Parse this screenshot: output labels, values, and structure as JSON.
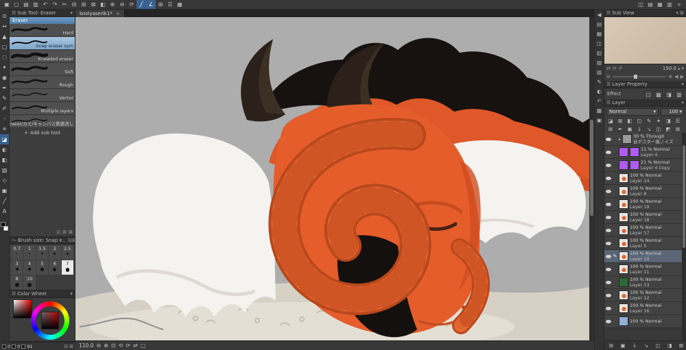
{
  "colors": {
    "accent": "#39618f",
    "selection_blue": "#7fa6cb",
    "canvas_bg": "#adadad",
    "dragon_orange": "#e2662f"
  },
  "top_toolbar": {
    "left_icons": [
      {
        "name": "app-logo-icon",
        "glyph": "▣"
      },
      {
        "name": "new-file-icon",
        "glyph": "▢"
      },
      {
        "name": "open-file-icon",
        "glyph": "▤"
      },
      {
        "name": "save-icon",
        "glyph": "▥"
      },
      {
        "name": "undo-icon",
        "glyph": "↶"
      },
      {
        "name": "redo-icon",
        "glyph": "↷"
      },
      {
        "name": "cut-icon",
        "glyph": "✂"
      },
      {
        "name": "copy-icon",
        "glyph": "⊟"
      },
      {
        "name": "paste-icon",
        "glyph": "⊞"
      },
      {
        "name": "delete-icon",
        "glyph": "⊠"
      },
      {
        "name": "fill-icon",
        "glyph": "◧"
      },
      {
        "name": "zoom-in-icon",
        "glyph": "⊕"
      },
      {
        "name": "zoom-out-icon",
        "glyph": "⊖"
      },
      {
        "name": "rotate-canvas-icon",
        "glyph": "⟳"
      },
      {
        "name": "snap-to-ruler-icon",
        "glyph": "╱",
        "active": true
      },
      {
        "name": "snap-to-special-ruler-icon",
        "glyph": "∠",
        "active": true
      },
      {
        "name": "snap-to-grid-icon",
        "glyph": "⊞"
      },
      {
        "name": "show-ruler-icon",
        "glyph": "☰"
      },
      {
        "name": "show-grid-icon",
        "glyph": "▦"
      }
    ],
    "right_icons": [
      {
        "name": "workspace-panels-icon-1",
        "glyph": "◫"
      },
      {
        "name": "workspace-panels-icon-2",
        "glyph": "▤"
      },
      {
        "name": "workspace-panels-icon-3",
        "glyph": "▦"
      },
      {
        "name": "workspace-panels-icon-4",
        "glyph": "▥"
      },
      {
        "name": "collapse-all-panels-icon",
        "glyph": "»"
      }
    ]
  },
  "left_toolbar": {
    "tools": [
      {
        "name": "zoom-tool-icon",
        "glyph": "⊙"
      },
      {
        "name": "move-tool-icon",
        "glyph": "↔"
      },
      {
        "name": "object-tool-icon",
        "glyph": "▲"
      },
      {
        "name": "selection-tool-icon",
        "glyph": "▢"
      },
      {
        "name": "lasso-tool-icon",
        "glyph": "◌"
      },
      {
        "name": "wand-tool-icon",
        "glyph": "✦"
      },
      {
        "name": "eyedropper-tool-icon",
        "glyph": "◉"
      },
      {
        "name": "pen-tool-icon",
        "glyph": "✒"
      },
      {
        "name": "pencil-tool-icon",
        "glyph": "✎"
      },
      {
        "name": "brush-tool-icon",
        "glyph": "✐"
      },
      {
        "name": "airbrush-tool-icon",
        "glyph": "◦"
      },
      {
        "name": "decoration-tool-icon",
        "glyph": "✳"
      },
      {
        "name": "eraser-tool-icon",
        "glyph": "◪",
        "active": true
      },
      {
        "name": "blend-tool-icon",
        "glyph": "◐"
      },
      {
        "name": "fill-tool-icon",
        "glyph": "◧"
      },
      {
        "name": "gradient-tool-icon",
        "glyph": "▨"
      },
      {
        "name": "figure-tool-icon",
        "glyph": "◇"
      },
      {
        "name": "frame-border-tool-icon",
        "glyph": "▣"
      },
      {
        "name": "ruler-tool-icon",
        "glyph": "╱"
      },
      {
        "name": "text-tool-icon",
        "glyph": "A"
      }
    ]
  },
  "subtool_panel": {
    "title": "Sub Tool: Eraser",
    "tab": "Eraser",
    "items": [
      {
        "label": "Hard",
        "stroke": 3
      },
      {
        "label": "Snap eraser sym",
        "stroke": 2,
        "selected": true
      },
      {
        "label": "Kneaded eraser",
        "stroke": 4.5
      },
      {
        "label": "Soft",
        "stroke": 3.5
      },
      {
        "label": "Rough",
        "stroke": 2.5
      },
      {
        "label": "Vector",
        "stroke": 1.5
      },
      {
        "label": "Multiple layers",
        "stroke": 2
      },
      {
        "label": "Eraser/カミ/キャンバス質感消し",
        "stroke": 1.5
      }
    ],
    "add_button": "Add sub tool",
    "footer_icons": [
      {
        "name": "view-mode-icon",
        "glyph": "⊡"
      },
      {
        "name": "add-subtool-icon",
        "glyph": "⊞"
      },
      {
        "name": "delete-subtool-icon",
        "glyph": "⊠"
      }
    ]
  },
  "brush_size_panel": {
    "title": "Brush size: Snap e..",
    "sizes": [
      "0.7",
      "1",
      "1.5",
      "2",
      "2.5",
      "3",
      "4",
      "5",
      "6",
      "7",
      "8",
      "10"
    ],
    "selected": "7",
    "header_icons": [
      {
        "name": "pressure-settings-icon",
        "glyph": "⊟"
      },
      {
        "name": "close-panel-icon",
        "glyph": "⊠"
      }
    ]
  },
  "color_wheel_panel": {
    "title": "Color Wheel"
  },
  "color_values": [
    "0",
    "0",
    "91"
  ],
  "canvas": {
    "tab": "kostyaserik1*",
    "close_glyph": "×",
    "zoom": "110.0",
    "status_icons_left": [
      {
        "name": "zoom-out-icon",
        "glyph": "⊖"
      },
      {
        "name": "zoom-in-icon",
        "glyph": "⊕"
      },
      {
        "name": "fit-to-screen-icon",
        "glyph": "⊡"
      }
    ],
    "status_icons_right": [
      {
        "name": "rotate-left-icon",
        "glyph": "⟲"
      },
      {
        "name": "rotate-right-icon",
        "glyph": "⟳"
      },
      {
        "name": "flip-horizontal-icon",
        "glyph": "⇄"
      },
      {
        "name": "reset-rotation-icon",
        "glyph": "▢"
      }
    ]
  },
  "right_strip": {
    "icons": [
      {
        "name": "collapse-dock-arrow-icon",
        "glyph": "◀"
      },
      {
        "name": "quick-access-panel-icon",
        "glyph": "▤"
      },
      {
        "name": "material-panel-icon",
        "glyph": "▦"
      },
      {
        "name": "navigator-panel-icon",
        "glyph": "◫"
      },
      {
        "name": "subview-panel-icon",
        "glyph": "▥"
      },
      {
        "name": "layer-panel-icon",
        "glyph": "▧"
      },
      {
        "name": "layer-property-panel-icon",
        "glyph": "▨"
      },
      {
        "name": "tool-panel-icon",
        "glyph": "✎"
      },
      {
        "name": "color-panel-icon",
        "glyph": "◐"
      },
      {
        "name": "history-panel-icon",
        "glyph": "↶"
      },
      {
        "name": "information-panel-icon",
        "glyph": "▩"
      },
      {
        "name": "timeline-panel-icon",
        "glyph": "▣"
      }
    ]
  },
  "right_panel": {
    "subview": {
      "title": "Sub View",
      "zoom": "150.0",
      "control_icons": [
        {
          "name": "switch-image-icon",
          "glyph": "⇄"
        },
        {
          "name": "rotate-image-icon",
          "glyph": "⟳"
        },
        {
          "name": "auto-eyedropper-icon",
          "glyph": "✐"
        }
      ]
    },
    "layer_property": {
      "title": "Layer Property",
      "effect_label": "Effect",
      "effect_icons": [
        {
          "name": "border-effect-icon",
          "glyph": "▢"
        },
        {
          "name": "tone-effect-icon",
          "glyph": "▩"
        },
        {
          "name": "layer-color-effect-icon",
          "glyph": "◨"
        },
        {
          "name": "expression-color-icon",
          "glyph": "▥"
        }
      ]
    },
    "layer_panel": {
      "title": "Layer",
      "blend_mode": "Normal",
      "opacity": "100",
      "toolbar_row1": [
        {
          "name": "clip-to-layer-below-icon",
          "glyph": "◪"
        },
        {
          "name": "lock-layer-icon",
          "glyph": "⊠"
        },
        {
          "name": "lock-transparent-pixels-icon",
          "glyph": "◧"
        },
        {
          "name": "enable-mask-icon",
          "glyph": "◫"
        },
        {
          "name": "set-as-draft-icon",
          "glyph": "✎"
        },
        {
          "name": "reference-layer-icon",
          "glyph": "✦"
        },
        {
          "name": "two-pane-view-icon",
          "glyph": "◨"
        },
        {
          "name": "palette-menu-icon",
          "glyph": "☰"
        }
      ],
      "toolbar_row2": [
        {
          "name": "new-raster-layer-icon",
          "glyph": "⊞"
        },
        {
          "name": "new-vector-layer-icon",
          "glyph": "✒"
        },
        {
          "name": "new-layer-folder-icon",
          "glyph": "▣"
        },
        {
          "name": "transfer-down-icon",
          "glyph": "↓"
        },
        {
          "name": "merge-down-icon",
          "glyph": "↘"
        },
        {
          "name": "create-mask-icon",
          "glyph": "◫"
        },
        {
          "name": "mask-visibility-icon",
          "glyph": "◩"
        },
        {
          "name": "delete-layer-icon",
          "glyph": "⊠"
        }
      ],
      "footer_icons": [
        {
          "name": "new-layer-icon",
          "glyph": "⊞"
        },
        {
          "name": "new-folder-icon",
          "glyph": "▣"
        },
        {
          "name": "transfer-icon",
          "glyph": "↓"
        },
        {
          "name": "merge-icon",
          "glyph": "↘"
        },
        {
          "name": "mask-icon",
          "glyph": "◫"
        },
        {
          "name": "two-pane-icon",
          "glyph": "◨"
        },
        {
          "name": "delete-icon",
          "glyph": "⊠"
        }
      ],
      "layers": [
        {
          "opacity": "30",
          "mode": "Through",
          "name": "音ポスター風ノイズ",
          "thumb": "noise",
          "folder": true
        },
        {
          "opacity": "11",
          "mode": "Normal",
          "name": "Layer 4",
          "thumb": "purple",
          "thumb2": "purple"
        },
        {
          "opacity": "21",
          "mode": "Normal",
          "name": "Layer 4 Copy",
          "thumb": "purple",
          "thumb2": "purple"
        },
        {
          "opacity": "100",
          "mode": "Normal",
          "name": "Layer 14",
          "thumb": "art"
        },
        {
          "opacity": "100",
          "mode": "Normal",
          "name": "Layer 8",
          "thumb": "art"
        },
        {
          "opacity": "100",
          "mode": "Normal",
          "name": "Layer 19",
          "thumb": "art"
        },
        {
          "opacity": "100",
          "mode": "Normal",
          "name": "Layer 18",
          "thumb": "art"
        },
        {
          "opacity": "100",
          "mode": "Normal",
          "name": "Layer 17",
          "thumb": "art"
        },
        {
          "opacity": "100",
          "mode": "Normal",
          "name": "Layer 5",
          "thumb": "art"
        },
        {
          "opacity": "100",
          "mode": "Normal",
          "name": "Layer 10",
          "thumb": "art",
          "selected": true
        },
        {
          "opacity": "100",
          "mode": "Normal",
          "name": "Layer 11",
          "thumb": "art"
        },
        {
          "opacity": "100",
          "mode": "Normal",
          "name": "Layer 13",
          "thumb": "green"
        },
        {
          "opacity": "100",
          "mode": "Normal",
          "name": "Layer 12",
          "thumb": "art"
        },
        {
          "opacity": "100",
          "mode": "Normal",
          "name": "Layer 16",
          "thumb": "art"
        },
        {
          "opacity": "100",
          "mode": "Normal",
          "name": "",
          "thumb": "blue"
        }
      ]
    }
  }
}
